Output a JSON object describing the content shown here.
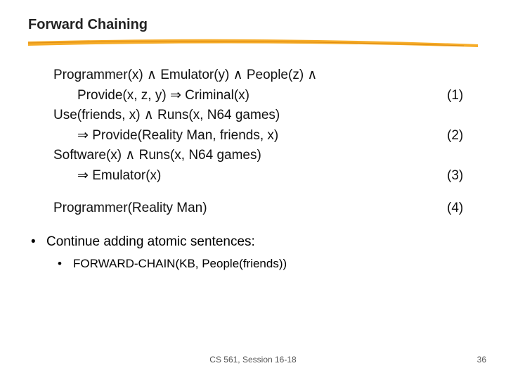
{
  "title": "Forward Chaining",
  "rules": {
    "r1a": "Programmer(x) ∧ Emulator(y) ∧ People(z) ∧",
    "r1b": "Provide(x, z, y) ⇒ Criminal(x)",
    "n1": "(1)",
    "r2a": "Use(friends, x) ∧ Runs(x, N64 games)",
    "r2b": "⇒ Provide(Reality Man, friends, x)",
    "n2": "(2)",
    "r3a": "Software(x) ∧ Runs(x, N64 games)",
    "r3b": "⇒ Emulator(x)",
    "n3": "(3)",
    "r4": "Programmer(Reality Man)",
    "n4": "(4)"
  },
  "bullets": {
    "b1": "Continue adding atomic sentences:",
    "b2": "FORWARD-CHAIN(KB, People(friends))"
  },
  "footer": {
    "center": "CS 561, Session 16-18",
    "page": "36"
  }
}
